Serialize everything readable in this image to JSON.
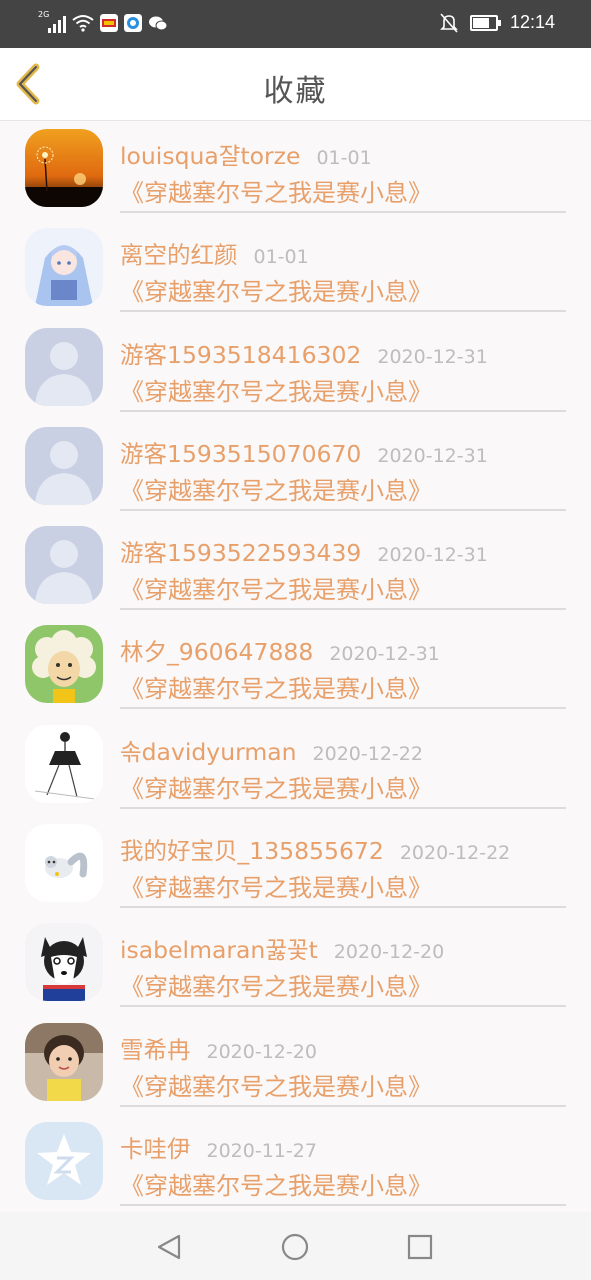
{
  "status_bar": {
    "network": "2G",
    "time": "12:14",
    "icons": [
      "signal-icon",
      "wifi-icon",
      "app-notification-icon",
      "qq-icon",
      "wechat-icon",
      "mute-bell-icon",
      "battery-icon"
    ],
    "battery_level": 0.8
  },
  "header": {
    "title": "收藏",
    "back_icon": "chevron-left-icon",
    "accent_color": "#e2b84a"
  },
  "colors": {
    "name": "#e8a06b",
    "date": "#bdbdbd",
    "divider": "#dcdcdc"
  },
  "favorites": [
    {
      "name": "louisqua쟐torze",
      "date": "01-01",
      "book": "《穿越塞尔号之我是赛小息》",
      "avatar": "dandelion-sunset-avatar"
    },
    {
      "name": "离空的红颜",
      "date": "01-01",
      "book": "《穿越塞尔号之我是赛小息》",
      "avatar": "anime-girl-avatar"
    },
    {
      "name": "游客1593518416302",
      "date": "2020-12-31",
      "book": "《穿越塞尔号之我是赛小息》",
      "avatar": "default-user-avatar"
    },
    {
      "name": "游客1593515070670",
      "date": "2020-12-31",
      "book": "《穿越塞尔号之我是赛小息》",
      "avatar": "default-user-avatar"
    },
    {
      "name": "游客1593522593439",
      "date": "2020-12-31",
      "book": "《穿越塞尔号之我是赛小息》",
      "avatar": "default-user-avatar"
    },
    {
      "name": "林夕_960647888",
      "date": "2020-12-31",
      "book": "《穿越塞尔号之我是赛小息》",
      "avatar": "cartoon-sheep-avatar"
    },
    {
      "name": "솎davidyurman",
      "date": "2020-12-22",
      "book": "《穿越塞尔号之我是赛小息》",
      "avatar": "sketch-girl-avatar"
    },
    {
      "name": "我的好宝贝_135855672",
      "date": "2020-12-22",
      "book": "《穿越塞尔号之我是赛小息》",
      "avatar": "cat-avatar"
    },
    {
      "name": "isabelmaran꿇꽃t",
      "date": "2020-12-20",
      "book": "《穿越塞尔号之我是赛小息》",
      "avatar": "husky-dog-avatar"
    },
    {
      "name": "雪希冉",
      "date": "2020-12-20",
      "book": "《穿越塞尔号之我是赛小息》",
      "avatar": "child-photo-avatar"
    },
    {
      "name": "卡哇伊",
      "date": "2020-11-27",
      "book": "《穿越塞尔号之我是赛小息》",
      "avatar": "qzone-star-avatar"
    }
  ],
  "nav_bar": {
    "back": "triangle-back-icon",
    "home": "circle-home-icon",
    "recents": "square-recents-icon"
  }
}
